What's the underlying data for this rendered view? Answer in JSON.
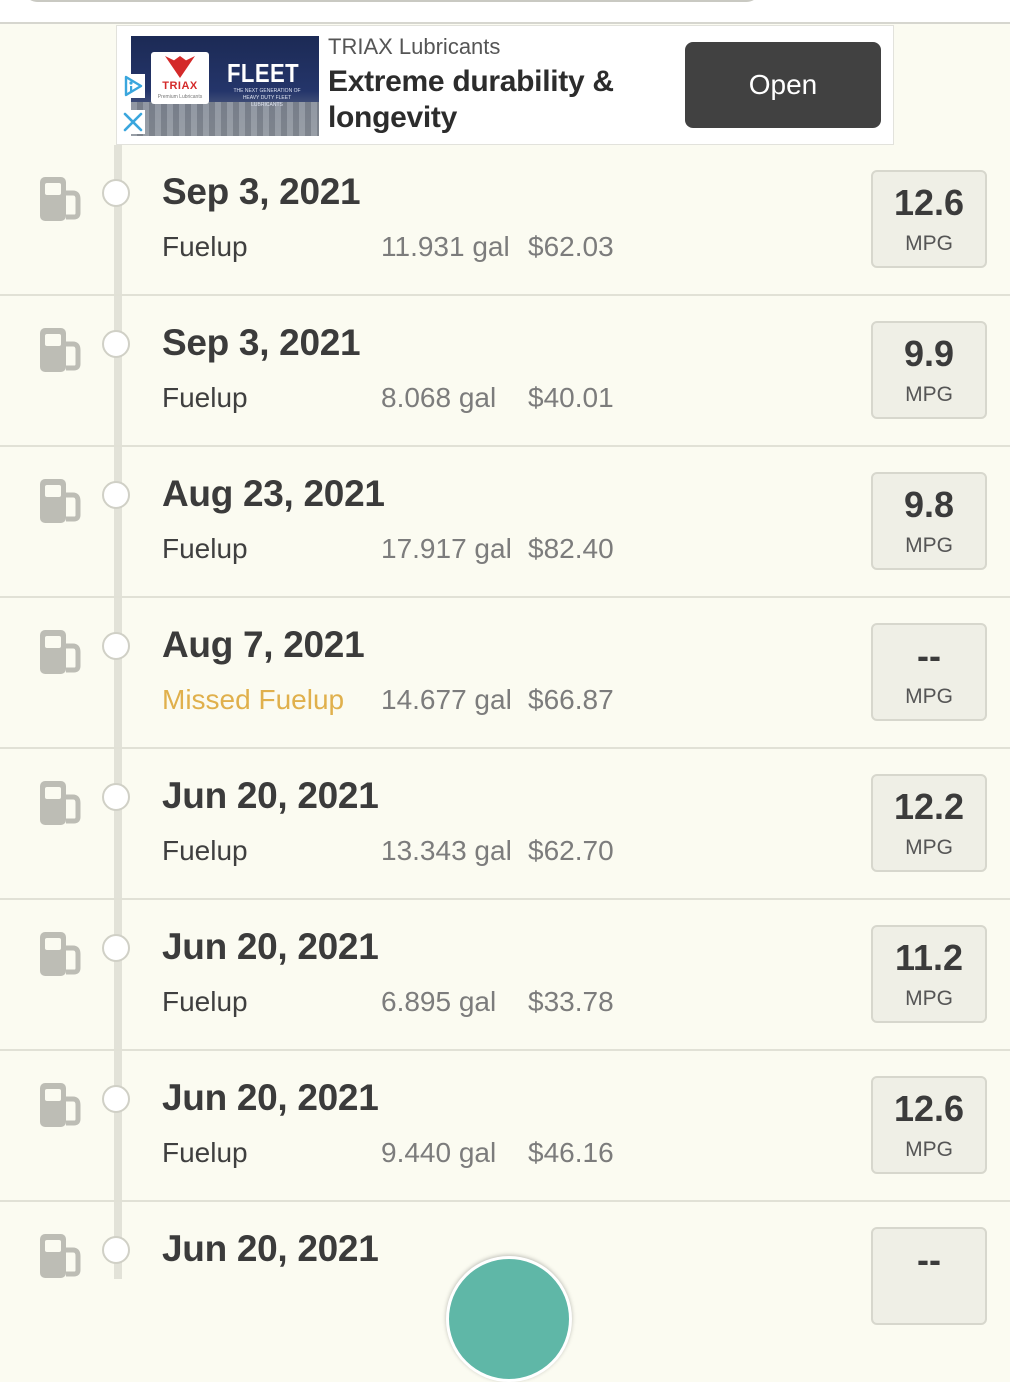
{
  "ad": {
    "advertiser": "TRIAX Lubricants",
    "headline": "Extreme durability & longevity",
    "cta": "Open",
    "image_brand": "TRIAX",
    "image_brand_sub": "Premium Lubricants",
    "image_title": "FLEET",
    "image_subtitle": "THE NEXT GENERATION OF HEAVY DUTY FLEET LUBRICANTS"
  },
  "colors": {
    "background": "#fbfbf1",
    "missed_fuelup": "#e0b04c",
    "fab": "#5fb7a7",
    "ad_button": "#414141"
  },
  "entries": [
    {
      "date": "Sep 3, 2021",
      "type": "Fuelup",
      "gallons": "11.931 gal",
      "cost": "$62.03",
      "mpg": "12.6",
      "unit": "MPG"
    },
    {
      "date": "Sep 3, 2021",
      "type": "Fuelup",
      "gallons": "8.068 gal",
      "cost": "$40.01",
      "mpg": "9.9",
      "unit": "MPG"
    },
    {
      "date": "Aug 23, 2021",
      "type": "Fuelup",
      "gallons": "17.917 gal",
      "cost": "$82.40",
      "mpg": "9.8",
      "unit": "MPG"
    },
    {
      "date": "Aug 7, 2021",
      "type": "Missed Fuelup",
      "gallons": "14.677 gal",
      "cost": "$66.87",
      "mpg": "--",
      "unit": "MPG"
    },
    {
      "date": "Jun 20, 2021",
      "type": "Fuelup",
      "gallons": "13.343 gal",
      "cost": "$62.70",
      "mpg": "12.2",
      "unit": "MPG"
    },
    {
      "date": "Jun 20, 2021",
      "type": "Fuelup",
      "gallons": "6.895 gal",
      "cost": "$33.78",
      "mpg": "11.2",
      "unit": "MPG"
    },
    {
      "date": "Jun 20, 2021",
      "type": "Fuelup",
      "gallons": "9.440 gal",
      "cost": "$46.16",
      "mpg": "12.6",
      "unit": "MPG"
    },
    {
      "date": "Jun 20, 2021",
      "type": "",
      "gallons": "",
      "cost": "",
      "mpg": "--",
      "unit": ""
    }
  ]
}
